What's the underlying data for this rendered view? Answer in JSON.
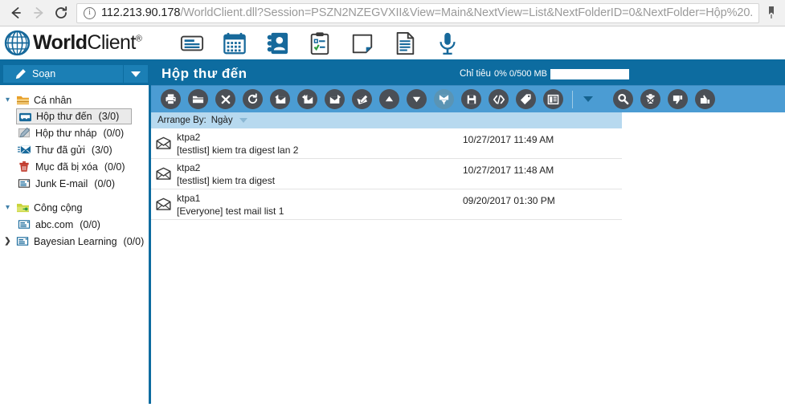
{
  "browser": {
    "back_icon": "back-arrow-icon",
    "forward_icon": "forward-arrow-icon",
    "reload_icon": "reload-icon",
    "site_info_icon": "info-circle-icon",
    "url_host": "112.213.90.178",
    "url_path": "/WorldClient.dll?Session=PSZN2NZEGVXII&View=Main&NextView=List&NextFolderID=0&NextFolder=Hộp%20...",
    "bookmark_icon": "bookmark-icon"
  },
  "header": {
    "logo_bold": "World",
    "logo_light": "Client",
    "logo_mark": "®",
    "globe_icon": "globe-icon",
    "app_icons": [
      {
        "name": "mail-icon",
        "label": "Mail"
      },
      {
        "name": "calendar-icon",
        "label": "Calendar"
      },
      {
        "name": "contacts-icon",
        "label": "Contacts"
      },
      {
        "name": "tasks-icon",
        "label": "Tasks"
      },
      {
        "name": "notes-icon",
        "label": "Notes"
      },
      {
        "name": "documents-icon",
        "label": "Documents"
      },
      {
        "name": "voice-icon",
        "label": "Voice"
      }
    ]
  },
  "sidebar": {
    "compose_label": "Soạn",
    "compose_icon": "pencil-icon",
    "compose_caret_icon": "chevron-down-icon",
    "groups": [
      {
        "name": "Cá nhân",
        "icon": "folder-personal-icon",
        "twisty": "expanded",
        "items": [
          {
            "label": "Hộp thư đến",
            "count": "(3/0)",
            "icon": "inbox-icon",
            "selected": true
          },
          {
            "label": "Hộp thư nháp",
            "count": "(0/0)",
            "icon": "drafts-icon",
            "selected": false
          },
          {
            "label": "Thư đã gửi",
            "count": "(3/0)",
            "icon": "sent-icon",
            "selected": false
          },
          {
            "label": "Mục đã bị xóa",
            "count": "(0/0)",
            "icon": "trash-icon",
            "selected": false
          },
          {
            "label": "Junk E-mail",
            "count": "(0/0)",
            "icon": "junk-icon",
            "selected": false
          }
        ]
      },
      {
        "name": "Công cộng",
        "icon": "folder-shared-icon",
        "twisty": "expanded",
        "items": [
          {
            "label": "abc.com",
            "count": "(0/0)",
            "icon": "public-folder-icon",
            "selected": false,
            "twisty": "none"
          },
          {
            "label": "Bayesian Learning",
            "count": "(0/0)",
            "icon": "public-folder-icon",
            "selected": false,
            "twisty": "collapsed"
          }
        ]
      }
    ]
  },
  "content": {
    "title": "Hộp thư đến",
    "quota_label": "Chỉ tiêu",
    "quota_value": "0% 0/500 MB",
    "quota_percent": 0,
    "toolbar": [
      {
        "name": "print-button",
        "icon": "printer-icon",
        "muted": false
      },
      {
        "name": "move-to-folder-button",
        "icon": "folder-open-icon",
        "muted": false
      },
      {
        "name": "delete-button",
        "icon": "x-close-icon",
        "muted": false
      },
      {
        "name": "refresh-button",
        "icon": "refresh-icon",
        "muted": false
      },
      {
        "name": "reply-button",
        "icon": "reply-envelope-icon",
        "muted": false
      },
      {
        "name": "reply-all-button",
        "icon": "reply-all-envelope-icon",
        "muted": false
      },
      {
        "name": "forward-button",
        "icon": "forward-envelope-icon",
        "muted": false
      },
      {
        "name": "edit-as-new-button",
        "icon": "edit-envelope-icon",
        "muted": false
      },
      {
        "name": "previous-button",
        "icon": "triangle-up-icon",
        "muted": false
      },
      {
        "name": "next-button",
        "icon": "triangle-down-icon",
        "muted": false
      },
      {
        "name": "filter-button",
        "icon": "funnel-envelope-icon",
        "muted": true
      },
      {
        "name": "save-button",
        "icon": "floppy-disk-icon",
        "muted": false
      },
      {
        "name": "view-source-button",
        "icon": "code-brackets-icon",
        "muted": false
      },
      {
        "name": "tag-button",
        "icon": "tag-icon",
        "muted": false
      },
      {
        "name": "layout-button",
        "icon": "columns-layout-icon",
        "muted": false
      }
    ],
    "toolbar_caret_icon": "chevron-down-icon",
    "toolbar_right": [
      {
        "name": "search-button",
        "icon": "magnifier-icon",
        "muted": false
      },
      {
        "name": "empty-trash-button",
        "icon": "trash-x-icon",
        "muted": false
      },
      {
        "name": "mark-spam-button",
        "icon": "thumbs-down-icon",
        "muted": false
      },
      {
        "name": "mark-not-spam-button",
        "icon": "thumbs-up-icon",
        "muted": false
      }
    ],
    "arrange": {
      "label": "Arrange By:",
      "value": "Ngày",
      "caret_icon": "caret-down-icon"
    },
    "messages": [
      {
        "from": "ktpa2",
        "subject": "[testlist] kiem tra digest lan 2",
        "date": "10/27/2017 11:49 AM",
        "envelope_icon": "closed-envelope-icon",
        "flag_icon": "flag-bookmark-icon"
      },
      {
        "from": "ktpa2",
        "subject": "[testlist] kiem tra digest",
        "date": "10/27/2017 11:48 AM",
        "envelope_icon": "closed-envelope-icon",
        "flag_icon": "flag-bookmark-icon"
      },
      {
        "from": "ktpa1",
        "subject": "[Everyone] test mail list 1",
        "date": "09/20/2017 01:30 PM",
        "envelope_icon": "closed-envelope-icon",
        "flag_icon": "flag-bookmark-icon"
      }
    ]
  },
  "colors": {
    "brand_dark_blue": "#0d6ca0",
    "toolbar_blue": "#4b9cd3",
    "arrange_blue": "#b7d9ef",
    "compose_blue": "#1b7fb5",
    "icon_dark": "#4a4f56",
    "logo_blue": "#17699b"
  }
}
